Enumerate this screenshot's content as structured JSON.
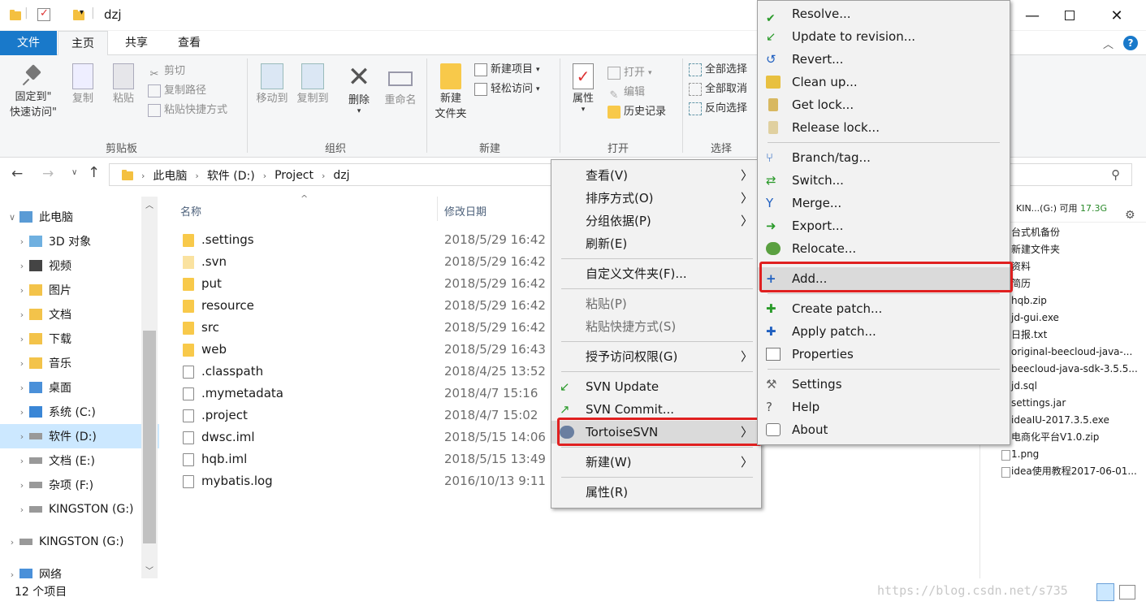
{
  "window": {
    "title": "dzj"
  },
  "ribbon_tabs": [
    {
      "label": "文件"
    },
    {
      "label": "主页"
    },
    {
      "label": "共享"
    },
    {
      "label": "查看"
    }
  ],
  "ribbon": {
    "clipboard": {
      "pin": "固定到\"",
      "pin2": "快速访问\"",
      "copy": "复制",
      "paste": "粘贴",
      "cut": "剪切",
      "copy_path": "复制路径",
      "paste_shortcut": "粘贴快捷方式",
      "group": "剪贴板"
    },
    "organize": {
      "move_to": "移动到",
      "copy_to": "复制到",
      "delete": "删除",
      "rename": "重命名",
      "group": "组织"
    },
    "new": {
      "new_folder": "新建",
      "new_folder2": "文件夹",
      "new_item": "新建项目",
      "easy_access": "轻松访问",
      "group": "新建"
    },
    "open": {
      "properties": "属性",
      "open": "打开",
      "edit": "编辑",
      "history": "历史记录",
      "group": "打开"
    },
    "select": {
      "select_all": "全部选择",
      "select_none": "全部取消",
      "invert": "反向选择",
      "group": "选择"
    }
  },
  "address": {
    "segments": [
      "此电脑",
      "软件 (D:)",
      "Project",
      "dzj"
    ]
  },
  "nav": [
    {
      "label": "此电脑"
    },
    {
      "label": "3D 对象"
    },
    {
      "label": "视频"
    },
    {
      "label": "图片"
    },
    {
      "label": "文档"
    },
    {
      "label": "下载"
    },
    {
      "label": "音乐"
    },
    {
      "label": "桌面"
    },
    {
      "label": "系统 (C:)"
    },
    {
      "label": "软件 (D:)"
    },
    {
      "label": "文档 (E:)"
    },
    {
      "label": "杂项 (F:)"
    },
    {
      "label": "KINGSTON (G:)"
    },
    {
      "label": "KINGSTON (G:)"
    },
    {
      "label": "网络"
    }
  ],
  "columns": {
    "name": "名称",
    "modified": "修改日期"
  },
  "files": [
    {
      "name": ".settings",
      "date": "2018/5/29 16:42",
      "type": "folder"
    },
    {
      "name": ".svn",
      "date": "2018/5/29 16:42",
      "type": "folder-light"
    },
    {
      "name": "put",
      "date": "2018/5/29 16:42",
      "type": "folder"
    },
    {
      "name": "resource",
      "date": "2018/5/29 16:42",
      "type": "folder"
    },
    {
      "name": "src",
      "date": "2018/5/29 16:42",
      "type": "folder"
    },
    {
      "name": "web",
      "date": "2018/5/29 16:43",
      "type": "folder"
    },
    {
      "name": ".classpath",
      "date": "2018/4/25 13:52",
      "type": "file"
    },
    {
      "name": ".mymetadata",
      "date": "2018/4/7 15:16",
      "type": "file"
    },
    {
      "name": ".project",
      "date": "2018/4/7 15:02",
      "type": "file"
    },
    {
      "name": "dwsc.iml",
      "date": "2018/5/15 14:06",
      "type": "file"
    },
    {
      "name": "hqb.iml",
      "date": "2018/5/15 13:49",
      "type": "file"
    },
    {
      "name": "mybatis.log",
      "date": "2016/10/13 9:11",
      "type": "file"
    }
  ],
  "context_menu": [
    {
      "label": "查看(V)"
    },
    {
      "label": "排序方式(O)"
    },
    {
      "label": "分组依据(P)"
    },
    {
      "label": "刷新(E)"
    },
    {
      "label": "自定义文件夹(F)..."
    },
    {
      "label": "粘贴(P)"
    },
    {
      "label": "粘贴快捷方式(S)"
    },
    {
      "label": "授予访问权限(G)"
    },
    {
      "label": "SVN Update"
    },
    {
      "label": "SVN Commit..."
    },
    {
      "label": "TortoiseSVN"
    },
    {
      "label": "新建(W)"
    },
    {
      "label": "属性(R)"
    }
  ],
  "svn_menu": [
    {
      "label": "Resolve..."
    },
    {
      "label": "Update to revision..."
    },
    {
      "label": "Revert..."
    },
    {
      "label": "Clean up..."
    },
    {
      "label": "Get lock..."
    },
    {
      "label": "Release lock..."
    },
    {
      "label": "Branch/tag..."
    },
    {
      "label": "Switch..."
    },
    {
      "label": "Merge..."
    },
    {
      "label": "Export..."
    },
    {
      "label": "Relocate..."
    },
    {
      "label": "Add..."
    },
    {
      "label": "Create patch..."
    },
    {
      "label": "Apply patch..."
    },
    {
      "label": "Properties"
    },
    {
      "label": "Settings"
    },
    {
      "label": "Help"
    },
    {
      "label": "About"
    }
  ],
  "drive_info": {
    "label": "KIN...(G:) 可用",
    "free": "17.3G"
  },
  "pane_items": [
    "台式机备份",
    "新建文件夹",
    "资料",
    "简历",
    "hqb.zip",
    "jd-gui.exe",
    "日报.txt",
    "original-beecloud-java-...",
    "beecloud-java-sdk-3.5.5...",
    "jd.sql",
    "settings.jar",
    "ideaIU-2017.3.5.exe",
    "电商化平台V1.0.zip",
    "1.png",
    "idea使用教程2017-06-01..."
  ],
  "status": {
    "count": "12 个项目"
  },
  "watermark": "https://blog.csdn.net/s735",
  "colors": {
    "accent": "#1979ca",
    "selection": "#cce8ff",
    "highlight_box": "#e02020"
  }
}
